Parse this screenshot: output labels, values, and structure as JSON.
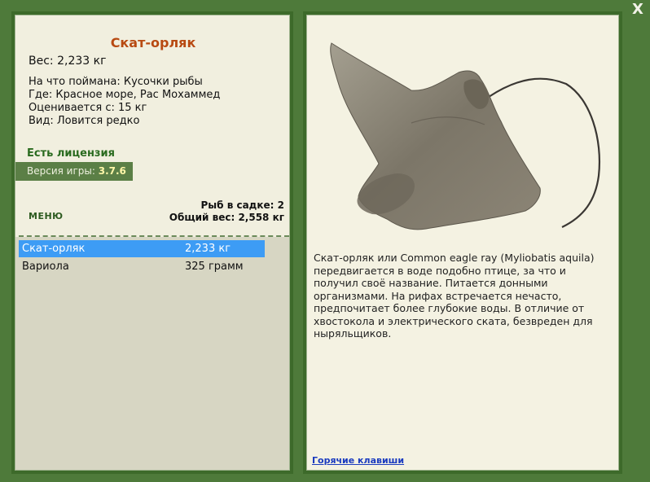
{
  "window": {
    "close_label": "X"
  },
  "fish": {
    "title": "Скат-орляк",
    "weight": "Вес: 2,233 кг",
    "bait": "На что поймана: Кусочки рыбы",
    "location": "Где: Красное море, Рас Мохаммед",
    "valued": "Оценивается с: 15 кг",
    "kind": "Вид: Ловится редко"
  },
  "license": "Есть лицензия",
  "version": {
    "label": "Версия игры:",
    "value": "3.7.6"
  },
  "menu_label": "МЕНЮ",
  "cage": {
    "count": "Рыб в садке: 2",
    "total": "Общий вес: 2,558 кг"
  },
  "catch_list": [
    {
      "name": "Скат-орляк",
      "weight": "2,233 кг",
      "selected": true
    },
    {
      "name": "Вариола",
      "weight": "325 грамм",
      "selected": false
    }
  ],
  "description": "Скат-орляк или Common eagle ray (Myliobatis aquila) передвигается в воде подобно птице, за что и получил своё название. Питается донными организмами. На рифах встречается нечасто, предпочитает более глубокие воды. В отличие от хвостокола и электрического ската, безвреден для ныряльщиков.",
  "hotkeys_label": "Горячие клавиши",
  "colors": {
    "accent": "#b84a12",
    "selection": "#3d9cf5",
    "frame": "#4e7a3a"
  },
  "icons": {
    "close": "close-icon",
    "fish_image": "eagle-ray-image"
  }
}
